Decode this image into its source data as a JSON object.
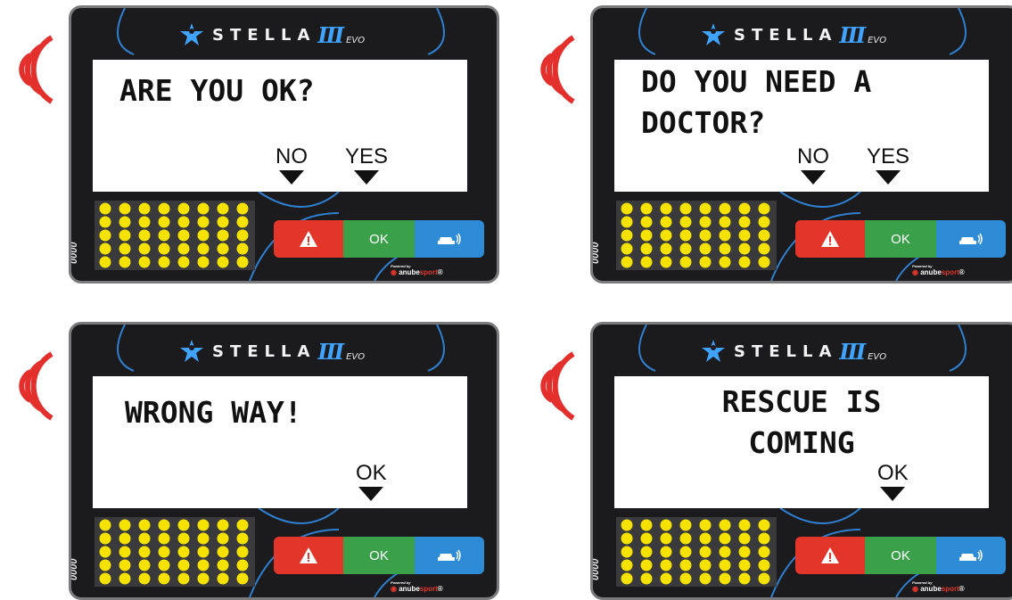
{
  "brand": {
    "name": "STELLA",
    "roman": "III",
    "edition": "EVO"
  },
  "counter": "0000",
  "powered_by": {
    "caption": "Powered by",
    "company_a": "anube",
    "company_b": "sport",
    "mark": "®"
  },
  "buttons": {
    "ok": "OK",
    "alert_icon": "warning-icon",
    "car_icon": "car-signal-icon"
  },
  "colors": {
    "alert": "#e2362b",
    "ok": "#3aa04a",
    "car": "#2e8bd6",
    "leds": "#f5e200",
    "accent": "#3fa3ff",
    "waves": "#e3302c"
  },
  "panels": [
    {
      "message": "ARE YOU OK?",
      "options": [
        "NO",
        "YES"
      ]
    },
    {
      "message": "DO YOU NEED A\nDOCTOR?",
      "options": [
        "NO",
        "YES"
      ]
    },
    {
      "message": "WRONG WAY!",
      "options": [
        "OK"
      ]
    },
    {
      "message": "RESCUE IS\nCOMING",
      "options": [
        "OK"
      ]
    }
  ]
}
